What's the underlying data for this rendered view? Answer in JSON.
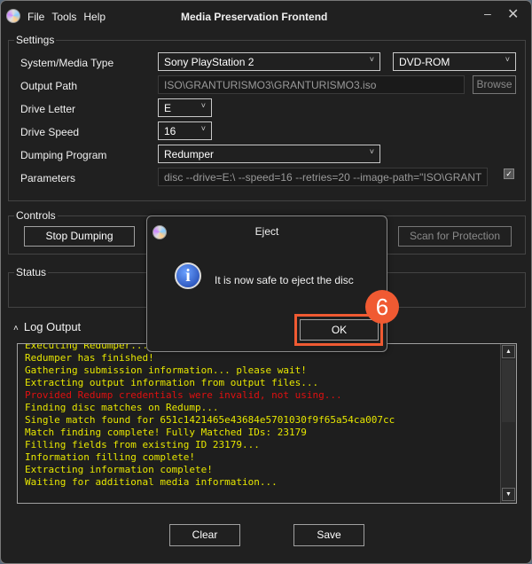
{
  "window": {
    "title": "Media Preservation Frontend",
    "menu": [
      "File",
      "Tools",
      "Help"
    ]
  },
  "settings": {
    "group_label": "Settings",
    "system_label": "System/Media Type",
    "system_value": "Sony PlayStation 2",
    "media_value": "DVD-ROM",
    "output_label": "Output Path",
    "output_value": "ISO\\GRANTURISMO3\\GRANTURISMO3.iso",
    "browse_label": "Browse",
    "drive_letter_label": "Drive Letter",
    "drive_letter_value": "E",
    "drive_speed_label": "Drive Speed",
    "drive_speed_value": "16",
    "program_label": "Dumping Program",
    "program_value": "Redumper",
    "parameters_label": "Parameters",
    "parameters_value": "disc --drive=E:\\ --speed=16 --retries=20 --image-path=\"ISO\\GRANT",
    "parameters_checked": true
  },
  "controls": {
    "group_label": "Controls",
    "stop_label": "Stop Dumping",
    "scan_label": "Scan for Protection"
  },
  "status": {
    "group_label": "Status"
  },
  "log": {
    "header": "Log Output",
    "lines": [
      {
        "text": "Executing Redumper...",
        "color": "#e6e600"
      },
      {
        "text": "Redumper has finished!",
        "color": "#e6e600"
      },
      {
        "text": "Gathering submission information... please wait!",
        "color": "#e6e600"
      },
      {
        "text": "Extracting output information from output files...",
        "color": "#e6e600"
      },
      {
        "text": "Provided Redump credentials were invalid, not using...",
        "color": "#e01010"
      },
      {
        "text": "Finding disc matches on Redump...",
        "color": "#e6e600"
      },
      {
        "text": "Single match found for 651c1421465e43684e5701030f9f65a54ca007cc",
        "color": "#e6e600"
      },
      {
        "text": "Match finding complete! Fully Matched IDs: 23179",
        "color": "#e6e600"
      },
      {
        "text": "Filling fields from existing ID 23179...",
        "color": "#e6e600"
      },
      {
        "text": "Information filling complete!",
        "color": "#e6e600"
      },
      {
        "text": "Extracting information complete!",
        "color": "#e6e600"
      },
      {
        "text": "Waiting for additional media information...",
        "color": "#e6e600"
      }
    ]
  },
  "footer": {
    "clear_label": "Clear",
    "save_label": "Save"
  },
  "dialog": {
    "title": "Eject",
    "message": "It is now safe to eject the disc",
    "ok_label": "OK",
    "icon": "info-icon"
  },
  "annotation": {
    "step": "6",
    "color": "#f05a32"
  }
}
